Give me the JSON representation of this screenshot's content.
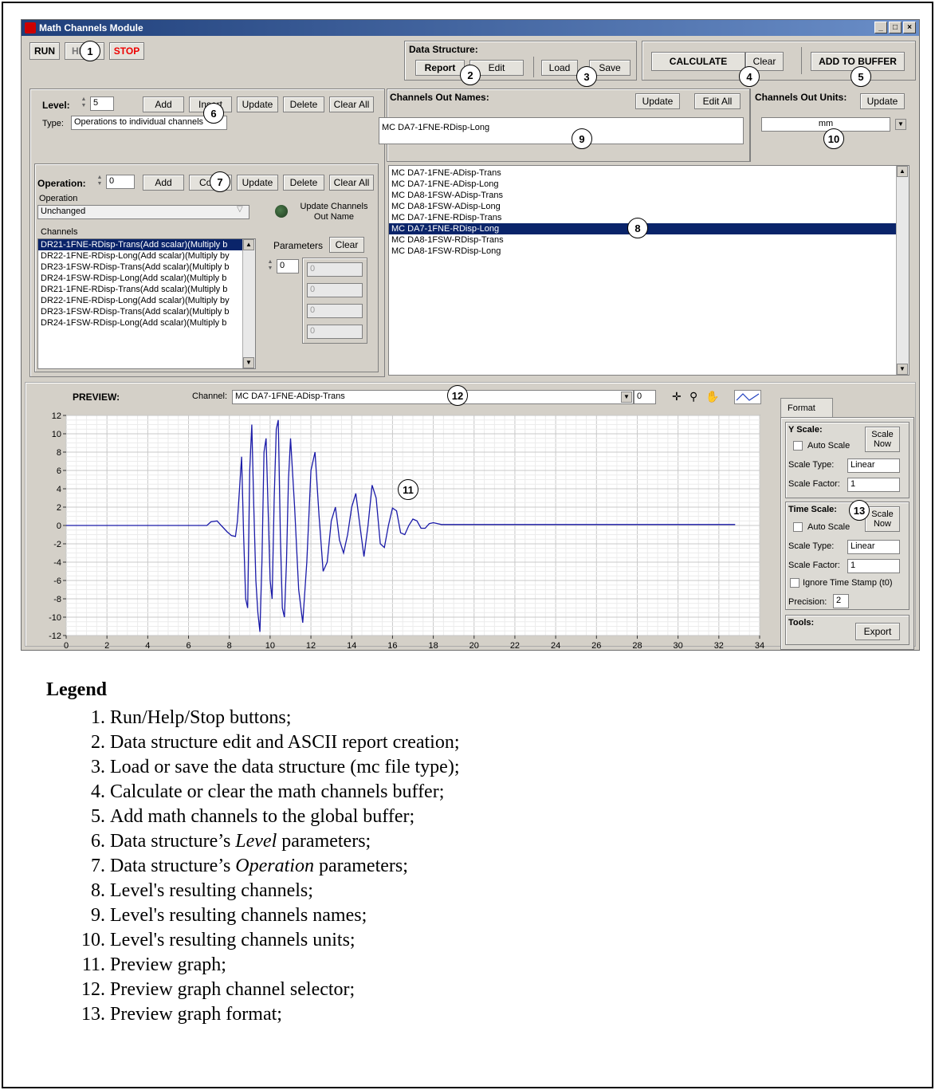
{
  "window": {
    "title": "Math Channels Module"
  },
  "top": {
    "run": "RUN",
    "help": "HELP",
    "stop": "STOP",
    "data_structure_label": "Data Structure:",
    "report": "Report",
    "edit": "Edit",
    "load": "Load",
    "save": "Save",
    "calculate": "CALCULATE",
    "clear": "Clear",
    "add_to_buffer": "ADD TO BUFFER"
  },
  "level": {
    "label": "Level:",
    "value": "5",
    "add": "Add",
    "insert": "Insert",
    "update": "Update",
    "delete": "Delete",
    "clear_all": "Clear All",
    "type_label": "Type:",
    "type_value": "Operations to individual channels"
  },
  "operation": {
    "label": "Operation:",
    "value": "0",
    "add": "Add",
    "copy": "Copy",
    "update": "Update",
    "delete": "Delete",
    "clear_all": "Clear All",
    "op_label": "Operation",
    "op_value": "Unchanged",
    "update_channels_label": "Update Channels Out Name",
    "channels_label": "Channels",
    "channels": [
      "DR21-1FNE-RDisp-Trans(Add scalar)(Multiply b",
      "DR22-1FNE-RDisp-Long(Add scalar)(Multiply by",
      "DR23-1FSW-RDisp-Trans(Add scalar)(Multiply b",
      "DR24-1FSW-RDisp-Long(Add scalar)(Multiply b",
      "DR21-1FNE-RDisp-Trans(Add scalar)(Multiply b",
      "DR22-1FNE-RDisp-Long(Add scalar)(Multiply by",
      "DR23-1FSW-RDisp-Trans(Add scalar)(Multiply b",
      "DR24-1FSW-RDisp-Long(Add scalar)(Multiply b"
    ],
    "parameters_label": "Parameters",
    "parameters_clear": "Clear",
    "param_index": "0",
    "params": [
      "0",
      "0",
      "0",
      "0"
    ]
  },
  "channels_out": {
    "names_label": "Channels Out Names:",
    "update": "Update",
    "edit_all": "Edit All",
    "name_value": "MC DA7-1FNE-RDisp-Long",
    "units_label": "Channels Out Units:",
    "units_update": "Update",
    "units_value": "mm",
    "list": [
      "MC DA7-1FNE-ADisp-Trans",
      "MC DA7-1FNE-ADisp-Long",
      "MC DA8-1FSW-ADisp-Trans",
      "MC DA8-1FSW-ADisp-Long",
      "MC DA7-1FNE-RDisp-Trans",
      "MC DA7-1FNE-RDisp-Long",
      "MC DA8-1FSW-RDisp-Trans",
      "MC DA8-1FSW-RDisp-Long"
    ],
    "selected_index": 5
  },
  "preview": {
    "label": "PREVIEW:",
    "channel_label": "Channel:",
    "channel_value": "MC DA7-1FNE-ADisp-Trans",
    "index": "0"
  },
  "format": {
    "tab": "Format",
    "y_scale_label": "Y Scale:",
    "scale_now": "Scale Now",
    "auto_scale": "Auto Scale",
    "scale_type_label": "Scale Type:",
    "scale_type": "Linear",
    "scale_factor_label": "Scale Factor:",
    "scale_factor": "1",
    "time_scale_label": "Time Scale:",
    "ignore_t0": "Ignore Time Stamp (t0)",
    "precision_label": "Precision:",
    "precision": "2",
    "tools_label": "Tools:",
    "export": "Export"
  },
  "callouts": [
    "1",
    "2",
    "3",
    "4",
    "5",
    "6",
    "7",
    "8",
    "9",
    "10",
    "11",
    "12",
    "13"
  ],
  "chart_data": {
    "type": "line",
    "xlim": [
      0,
      34
    ],
    "ylim": [
      -12,
      12
    ],
    "x_ticks": [
      "0",
      "2",
      "4",
      "6",
      "8",
      "10",
      "12",
      "14",
      "16",
      "18",
      "20",
      "22",
      "24",
      "26",
      "28",
      "30",
      "32",
      "34"
    ],
    "y_ticks": [
      "12",
      "10",
      "8",
      "6",
      "4",
      "2",
      "0",
      "-2",
      "-4",
      "-6",
      "-8",
      "-10",
      "-12"
    ],
    "series": [
      {
        "color": "#1a1aa8",
        "points": [
          [
            0,
            0
          ],
          [
            6.9,
            0
          ],
          [
            7.1,
            0.4
          ],
          [
            7.4,
            0.5
          ],
          [
            7.6,
            0
          ],
          [
            7.9,
            -0.7
          ],
          [
            8.1,
            -1.1
          ],
          [
            8.3,
            -1.2
          ],
          [
            8.4,
            0.5
          ],
          [
            8.5,
            4
          ],
          [
            8.6,
            7.5
          ],
          [
            8.7,
            -1
          ],
          [
            8.8,
            -8
          ],
          [
            8.9,
            -9
          ],
          [
            9.0,
            6
          ],
          [
            9.1,
            11
          ],
          [
            9.2,
            2
          ],
          [
            9.3,
            -6
          ],
          [
            9.4,
            -9.5
          ],
          [
            9.5,
            -11.6
          ],
          [
            9.6,
            -4
          ],
          [
            9.7,
            8
          ],
          [
            9.8,
            9.5
          ],
          [
            9.9,
            2
          ],
          [
            10.0,
            -6
          ],
          [
            10.1,
            -8
          ],
          [
            10.2,
            3
          ],
          [
            10.3,
            10.5
          ],
          [
            10.4,
            11.5
          ],
          [
            10.5,
            -1
          ],
          [
            10.6,
            -9
          ],
          [
            10.7,
            -10
          ],
          [
            10.8,
            -4
          ],
          [
            10.9,
            5
          ],
          [
            11.0,
            9.5
          ],
          [
            11.2,
            2
          ],
          [
            11.4,
            -7
          ],
          [
            11.6,
            -10.6
          ],
          [
            11.8,
            -4
          ],
          [
            12.0,
            6
          ],
          [
            12.2,
            8
          ],
          [
            12.4,
            1
          ],
          [
            12.6,
            -5
          ],
          [
            12.8,
            -4
          ],
          [
            13.0,
            0.5
          ],
          [
            13.2,
            2
          ],
          [
            13.4,
            -1.6
          ],
          [
            13.6,
            -3
          ],
          [
            13.8,
            -1
          ],
          [
            14.0,
            2
          ],
          [
            14.2,
            3.5
          ],
          [
            14.4,
            0
          ],
          [
            14.6,
            -3.4
          ],
          [
            14.8,
            0
          ],
          [
            15.0,
            4.4
          ],
          [
            15.2,
            3
          ],
          [
            15.4,
            -2
          ],
          [
            15.6,
            -2.4
          ],
          [
            15.8,
            0
          ],
          [
            16.0,
            1.9
          ],
          [
            16.2,
            1.6
          ],
          [
            16.4,
            -0.8
          ],
          [
            16.6,
            -1
          ],
          [
            16.8,
            0
          ],
          [
            17.0,
            0.7
          ],
          [
            17.2,
            0.5
          ],
          [
            17.4,
            -0.3
          ],
          [
            17.6,
            -0.3
          ],
          [
            17.8,
            0.2
          ],
          [
            18.0,
            0.3
          ],
          [
            18.4,
            0.1
          ],
          [
            18.6,
            0.1
          ],
          [
            32.8,
            0.1
          ]
        ]
      }
    ]
  },
  "legend": {
    "title": "Legend",
    "items": [
      "Run/Help/Stop buttons;",
      "Data structure edit and ASCII report creation;",
      "Load or save the data structure (mc file type);",
      "Calculate or clear the math channels buffer;",
      "Add math channels to the global buffer;",
      "Data structure’s Level parameters;",
      "Data structure’s Operation parameters;",
      "Level's resulting channels;",
      "Level's resulting channels names;",
      "Level's resulting channels units;",
      "Preview graph;",
      "Preview graph channel selector;",
      "Preview graph format;"
    ]
  }
}
